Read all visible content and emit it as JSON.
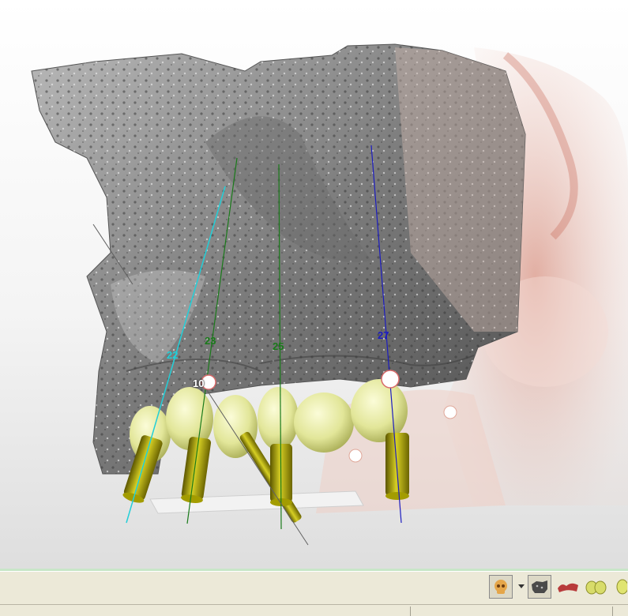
{
  "viewer": {
    "implant_labels": [
      {
        "id": "implant-22",
        "text": "22",
        "color": "#22cfd8"
      },
      {
        "id": "implant-23",
        "text": "23",
        "color": "#1a7a1a"
      },
      {
        "id": "implant-25",
        "text": "25",
        "color": "#1a7a1a"
      },
      {
        "id": "implant-27",
        "text": "27",
        "color": "#1c1cc0"
      },
      {
        "id": "nerve-point-10",
        "text": "10",
        "color": "#d8d8d8"
      }
    ]
  },
  "toolbar": {
    "buttons": [
      {
        "name": "skull-view-button",
        "icon": "skull-icon",
        "active": true
      },
      {
        "name": "view-options-dropdown",
        "icon": "chevron-down-icon",
        "active": false
      },
      {
        "name": "bone-surface-button",
        "icon": "bone-icon",
        "active": true
      },
      {
        "name": "soft-tissue-button",
        "icon": "soft-tissue-icon",
        "active": false
      },
      {
        "name": "teeth-button",
        "icon": "teeth-icon",
        "active": false
      },
      {
        "name": "crown-button",
        "icon": "crown-icon",
        "active": false
      }
    ]
  },
  "colors": {
    "bone": "#8c8c8c",
    "implant": "#b8b000",
    "crown": "#e8eca0",
    "soft_tissue": "#e6b8ac",
    "toolbar_bg": "#ece9d8"
  }
}
